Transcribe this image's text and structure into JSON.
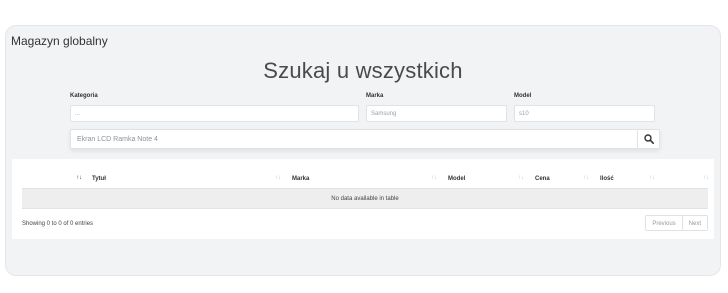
{
  "card": {
    "title": "Magazyn globalny"
  },
  "search": {
    "headline": "Szukaj u wszystkich",
    "filters": [
      {
        "label": "Kategoria",
        "placeholder": "..."
      },
      {
        "label": "Marka",
        "placeholder": "Samsung"
      },
      {
        "label": "Model",
        "placeholder": "s10"
      }
    ],
    "query_placeholder": "Ekran LCD Ramka Note 4"
  },
  "table": {
    "columns": [
      "Tytuł",
      "Marka",
      "Model",
      "Cena",
      "Ilość"
    ],
    "empty_message": "No data available in table",
    "info": "Showing 0 to 0 of 0 entries",
    "pagination": {
      "previous": "Previous",
      "next": "Next"
    }
  },
  "icons": {
    "search": "search-icon",
    "sort": "sort-icon"
  }
}
